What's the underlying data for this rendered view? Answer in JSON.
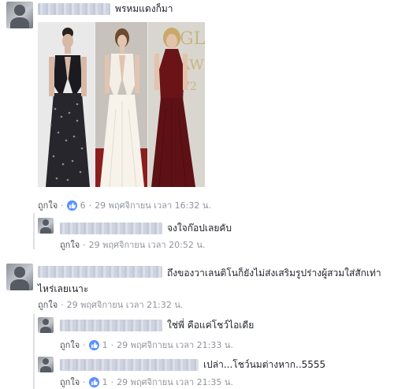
{
  "comments": [
    {
      "id": "c1",
      "text": "พรหมแดงก็มา",
      "like_label": "ถูกใจ",
      "reaction_count": "6",
      "timestamp": "29 พฤศจิกายน เวลา 16:32 น.",
      "replies": [
        {
          "text": "จงใจก๊อปเลยคับ",
          "like_label": "ถูกใจ",
          "timestamp": "29 พฤศจิกายน เวลา 20:52 น."
        }
      ]
    },
    {
      "id": "c2",
      "text": "ถึงของวาเลนติโนก็ยังไม่ส่งเสริมรูปร่างผู้สวมใส่สักเท่าไหร่เลยเนาะ",
      "like_label": "ถูกใจ",
      "timestamp": "29 พฤศจิกายน เวลา 21:32 น.",
      "replies": [
        {
          "text": "ใช่พี่ คือแค่โชว์ไอเดีย",
          "like_label": "ถูกใจ",
          "reaction_count": "1",
          "timestamp": "29 พฤศจิกายน เวลา 21:33 น."
        },
        {
          "text": "เปล่า...โชว์นมต่างหาก..5555",
          "like_label": "ถูกใจ",
          "reaction_count": "1",
          "timestamp": "29 พฤศจิกายน เวลา 21:35 น."
        }
      ]
    }
  ],
  "colors": {
    "accent": "#365899",
    "meta": "#90949c",
    "like_badge": "#5890ff"
  },
  "icons": {
    "reaction": "thumbs-up-icon"
  }
}
